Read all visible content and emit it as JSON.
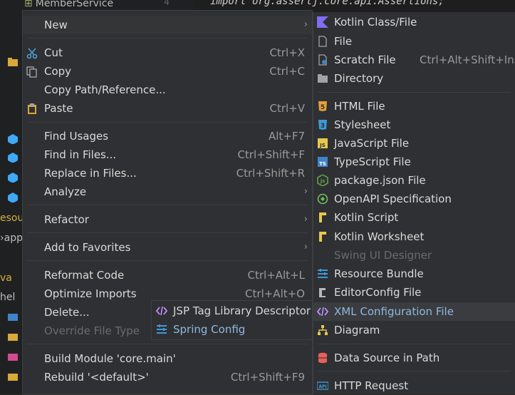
{
  "background": {
    "project_tree_top": "MemberService",
    "line_number": "4",
    "code_line": "import org.assertj.core.api.Assertions;",
    "side_labels": [
      "esour",
      "app",
      "va",
      "hel"
    ]
  },
  "context_menu": {
    "new": "New",
    "cut": "Cut",
    "cut_sc": "Ctrl+X",
    "copy": "Copy",
    "copy_sc": "Ctrl+C",
    "copy_path": "Copy Path/Reference...",
    "paste": "Paste",
    "paste_sc": "Ctrl+V",
    "find_usages": "Find Usages",
    "find_usages_sc": "Alt+F7",
    "find_in_files": "Find in Files...",
    "find_in_files_sc": "Ctrl+Shift+F",
    "replace_in_files": "Replace in Files...",
    "replace_in_files_sc": "Ctrl+Shift+R",
    "analyze": "Analyze",
    "refactor": "Refactor",
    "add_to_favorites": "Add to Favorites",
    "reformat_code": "Reformat Code",
    "reformat_code_sc": "Ctrl+Alt+L",
    "optimize_imports": "Optimize Imports",
    "optimize_imports_sc": "Ctrl+Alt+O",
    "delete": "Delete...",
    "override_file_type": "Override File Type",
    "build_module": "Build Module 'core.main'",
    "rebuild": "Rebuild '<default>'",
    "rebuild_sc": "Ctrl+Shift+F9"
  },
  "new_submenu": {
    "kotlin_class": "Kotlin Class/File",
    "file": "File",
    "scratch_file": "Scratch File",
    "scratch_file_sc": "Ctrl+Alt+Shift+Inse",
    "directory": "Directory",
    "html_file": "HTML File",
    "stylesheet": "Stylesheet",
    "javascript_file": "JavaScript File",
    "typescript_file": "TypeScript File",
    "package_json": "package.json File",
    "openapi": "OpenAPI Specification",
    "kotlin_script": "Kotlin Script",
    "kotlin_worksheet": "Kotlin Worksheet",
    "swing_ui": "Swing UI Designer",
    "resource_bundle": "Resource Bundle",
    "editorconfig": "EditorConfig File",
    "xml_config": "XML Configuration File",
    "diagram": "Diagram",
    "data_source": "Data Source in Path",
    "http_request": "HTTP Request"
  },
  "xml_submenu": {
    "jsp_tag": "JSP Tag Library Descriptor",
    "spring_config": "Spring Config"
  },
  "colors": {
    "menu_bg": "#2f3033",
    "selected_text": "#8fb8e0",
    "kotlin": "#7f6df2",
    "html": "#e8a03a",
    "css": "#3c9ad6",
    "js": "#e6c84f",
    "ts": "#3f84c9",
    "node": "#5fa04e",
    "xml": "#c090ff",
    "db": "#e8615a"
  }
}
